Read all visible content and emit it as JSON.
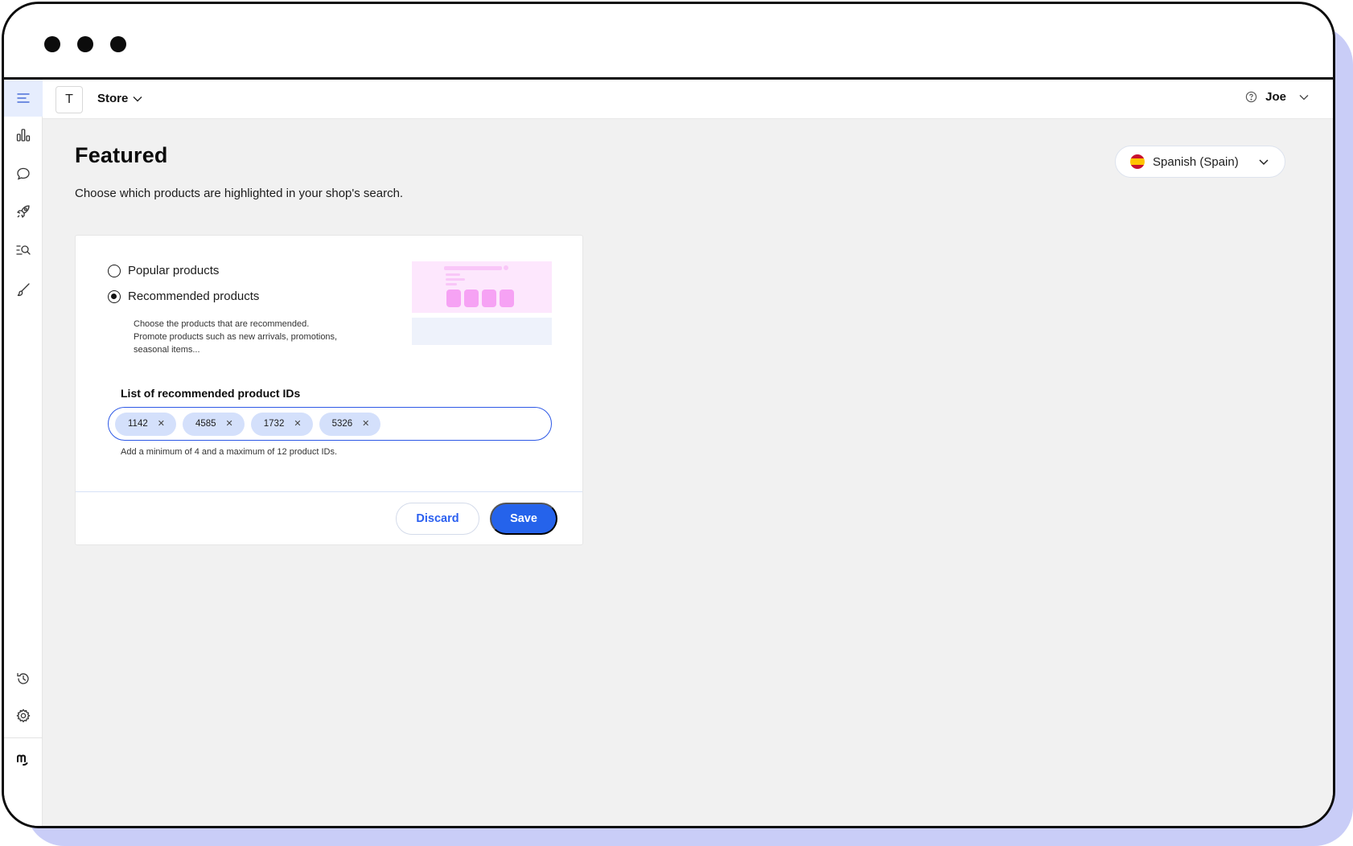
{
  "header": {
    "store_initial": "T",
    "store_label": "Store",
    "user_name": "Joe"
  },
  "sidebar": {
    "items": [
      {
        "icon": "menu-icon",
        "active": true
      },
      {
        "icon": "bar-chart-icon"
      },
      {
        "icon": "chat-bubble-icon"
      },
      {
        "icon": "rocket-icon"
      },
      {
        "icon": "search-list-icon"
      },
      {
        "icon": "brush-icon"
      },
      {
        "icon": "history-icon"
      },
      {
        "icon": "gear-icon"
      },
      {
        "icon": "brand-logo-icon"
      }
    ]
  },
  "page": {
    "title": "Featured",
    "subtitle": "Choose which products are highlighted in your shop's search.",
    "language": "Spanish (Spain)"
  },
  "card": {
    "option_popular": "Popular products",
    "option_recommended": "Recommended products",
    "selected": "recommended",
    "recommended_description": "Choose the products that are recommended. Promote products such as new arrivals, promotions, seasonal items...",
    "field_label": "List of recommended product IDs",
    "product_ids": [
      "1142",
      "4585",
      "1732",
      "5326"
    ],
    "field_help": "Add a minimum of 4 and a maximum of 12 product IDs.",
    "discard_label": "Discard",
    "save_label": "Save"
  },
  "colors": {
    "accent": "#2563eb",
    "chip_bg": "#d4e0fb",
    "window_shadow": "#c9cdf7",
    "preview_pink": "#f6a2f4"
  }
}
